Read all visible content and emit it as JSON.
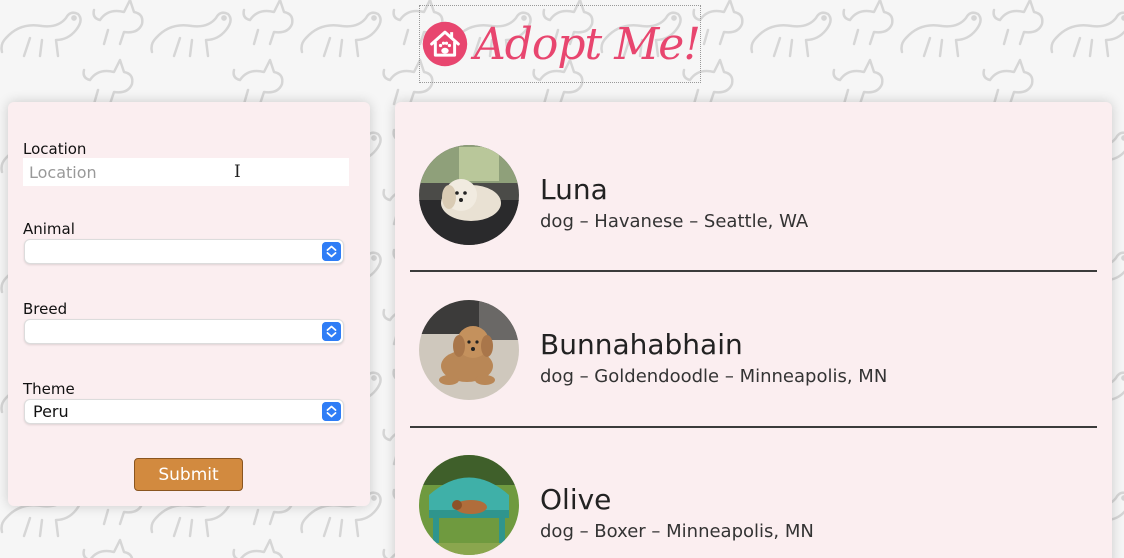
{
  "header": {
    "logo_text": "Adopt Me!"
  },
  "search": {
    "location_label": "Location",
    "location_placeholder": "Location",
    "location_value": "",
    "animal_label": "Animal",
    "animal_value": "",
    "breed_label": "Breed",
    "breed_value": "",
    "theme_label": "Theme",
    "theme_value": "Peru",
    "submit_label": "Submit"
  },
  "results": [
    {
      "name": "Luna",
      "info": "dog – Havanese – Seattle, WA"
    },
    {
      "name": "Bunnahabhain",
      "info": "dog – Goldendoodle – Minneapolis, MN"
    },
    {
      "name": "Olive",
      "info": "dog – Boxer – Minneapolis, MN"
    }
  ],
  "colors": {
    "brand": "#e8466f",
    "panel": "#fbeef0",
    "button": "#d28a3f",
    "select_accent": "#2f7df6"
  }
}
